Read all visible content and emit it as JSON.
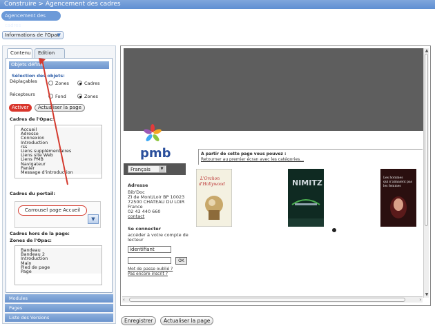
{
  "header": {
    "title": "Construire > Agencement des cadres",
    "section_button": "Agencement des cadres"
  },
  "opac_dropdown": {
    "label": "Informations de l'Opac"
  },
  "tabs": [
    {
      "label": "Contenu"
    },
    {
      "label": "Edition CSS"
    }
  ],
  "objets": {
    "header": "Objets définis",
    "selection_label": "Sélection des objets:",
    "deplacables_label": "Déplaçables",
    "recepteurs_label": "Récepteurs",
    "options": {
      "zones": "Zones",
      "cadres": "Cadres",
      "fond": "Fond",
      "zones2": "Zones"
    },
    "activer": "Activer",
    "actualiser": "Actualiser la page"
  },
  "cadres_opac": {
    "label": "Cadres de l'Opac:",
    "items": [
      "Accueil",
      "Adresse",
      "Connexion",
      "Introduction",
      "rss",
      "Liens supplémentaires",
      "Liens site Web",
      "Liens PMB",
      "Navigateur",
      "Panier",
      "Message d'introduction"
    ]
  },
  "cadres_portail": {
    "label": "Cadres du portail:",
    "item": "Carrousel page Accueil"
  },
  "cadres_hors": {
    "label": "Cadres hors de la page:",
    "zones_label": "Zones de l'Opac:",
    "items": [
      "Bandeau",
      "Bandeau 2",
      "Introduction",
      "Main",
      "Pied de page",
      "Page"
    ]
  },
  "accordion": [
    "Modules",
    "Pages",
    "Liste des Versions"
  ],
  "preview": {
    "logo_text": "pmb",
    "language": "Français",
    "right_panel_title": "A partir de cette page vous pouvez :",
    "right_panel_link": "Retourner au premier écran avec les catégories...",
    "address": {
      "heading": "Adresse",
      "lines": [
        "Bib'Doc",
        "ZI de Mont/Loir BP 10023",
        "72500 CHATEAU DU LOIR",
        "France",
        "02 43 440 660"
      ],
      "contact": "contact"
    },
    "connect": {
      "heading": "Se connecter",
      "text_line1": "accéder à votre compte de",
      "text_line2": "lecteur",
      "login_value": "identifiant",
      "ok": "OK",
      "forgot": "Mot de passe oublié ?",
      "register": "Pas encore inscrit ?"
    },
    "books": [
      {
        "title": "L'Orchon d'Hollywood",
        "color": "#f4f1e1"
      },
      {
        "title": "NIMITZ",
        "color": "#0f2a22"
      },
      {
        "title": "Les hommes qui n'aimaient pas les femmes",
        "color": "#2a0f0f"
      }
    ]
  },
  "bottom": {
    "save": "Enregistrer",
    "refresh": "Actualiser la page"
  },
  "colors": {
    "topbar": "#6b97d6",
    "activer": "#d9362c",
    "highlight": "#d43a2e"
  }
}
